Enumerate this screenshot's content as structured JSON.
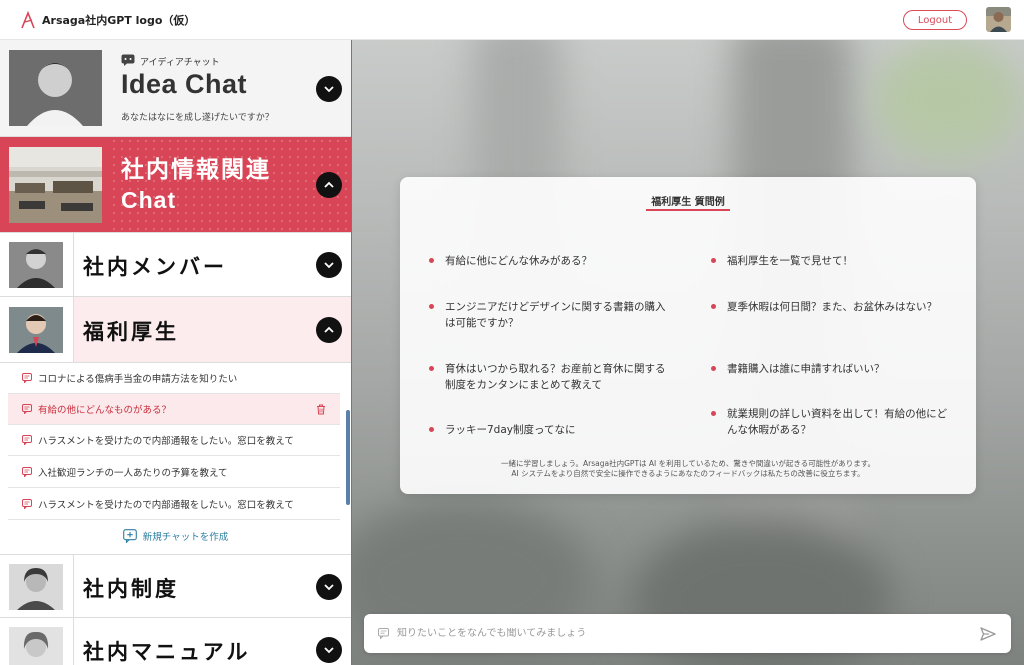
{
  "header": {
    "logo_text": "Arsaga社内GPT logo（仮）",
    "logout_label": "Logout",
    "accent": "#d84556"
  },
  "sidebar": {
    "idea": {
      "sub": "アイディアチャット",
      "title": "Idea Chat",
      "desc": "あなたはなにを成し遂げたいですか？",
      "toggle_icon": "chevron-down-icon"
    },
    "info": {
      "title_line1": "社内情報関連",
      "title_line2": "Chat",
      "toggle_icon": "chevron-up-icon"
    },
    "member": {
      "label": "社内メンバー",
      "toggle_icon": "chevron-down-icon"
    },
    "welfare": {
      "label": "福利厚生",
      "toggle_icon": "chevron-up-icon"
    },
    "chats": [
      {
        "label": "コロナによる傷病手当金の申請方法を知りたい",
        "active": false
      },
      {
        "label": "有給の他にどんなものがある？",
        "active": true
      },
      {
        "label": "ハラスメントを受けたので内部通報をしたい。窓口を教えて",
        "active": false
      },
      {
        "label": "入社歓迎ランチの一人あたりの予算を教えて",
        "active": false
      },
      {
        "label": "ハラスメントを受けたので内部通報をしたい。窓口を教えて",
        "active": false
      }
    ],
    "new_chat_label": "新規チャットを作成",
    "system": {
      "label": "社内制度",
      "toggle_icon": "chevron-down-icon"
    },
    "manual": {
      "label": "社内マニュアル",
      "toggle_icon": "chevron-down-icon"
    }
  },
  "examples": {
    "title": "福利厚生 質問例",
    "items": [
      "有給に他にどんな休みがある？",
      "福利厚生を一覧で見せて！",
      "エンジニアだけどデザインに関する書籍の購入は可能ですか？",
      "夏季休暇は何日間？また、お盆休みはない？",
      "育休はいつから取れる？お産前と育休に関する制度をカンタンにまとめて教えて",
      "書籍購入は誰に申請すればいい？",
      "ラッキー7day制度ってなに",
      "就業規則の詳しい資料を出して！有給の他にどんな休暇がある？"
    ],
    "note_line1": "一緒に学習しましょう。Arsaga社内GPTは AI を利用しているため、驚きや間違いが起きる可能性があります。",
    "note_line2": "AI システムをより自然で安全に操作できるようにあなたのフィードバックは私たちの改善に役立ちます。"
  },
  "input": {
    "placeholder": "知りたいことをなんでも聞いてみましょう",
    "value": ""
  }
}
